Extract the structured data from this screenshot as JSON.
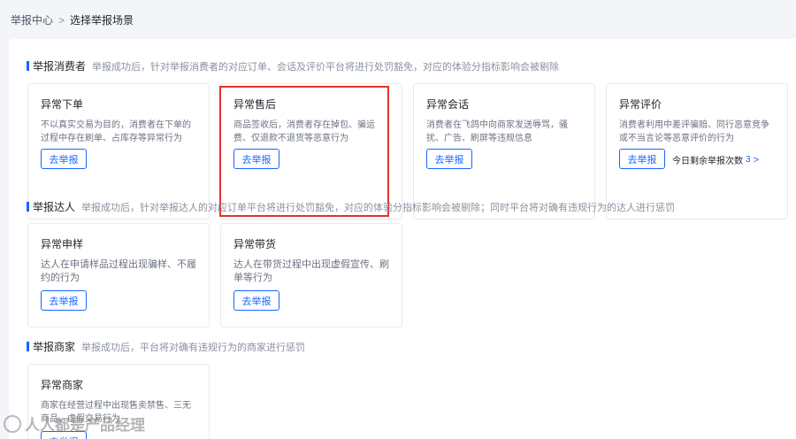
{
  "breadcrumb": {
    "root": "举报中心",
    "separator": ">",
    "current": "选择举报场景"
  },
  "sections": [
    {
      "label": "举报消费者",
      "note": "举报成功后，针对举报消费者的对应订单、会话及评价平台将进行处罚豁免，对应的体验分指标影响会被剔除",
      "cards": [
        {
          "title": "异常下单",
          "desc": "不以真实交易为目的，消费者在下单的过程中存在刷单、占库存等异常行为",
          "button": "去举报"
        },
        {
          "title": "异常售后",
          "desc": "商品签收后，消费者存在掉包、骗运费、仅退款不退货等恶意行为",
          "button": "去举报"
        },
        {
          "title": "异常会话",
          "desc": "消费者在飞鸽中向商家发送辱骂，骚扰、广告、刷屏等违规信息",
          "button": "去举报"
        },
        {
          "title": "异常评价",
          "desc": "消费者利用中差评骗赔、同行恶意竞争或不当言论等恶意评价的行为",
          "button": "去举报",
          "extra_label": "今日剩余举报次数",
          "extra_count": "3",
          "extra_arrow": ">"
        }
      ]
    },
    {
      "label": "举报达人",
      "note": "举报成功后，针对举报达人的对应订单平台将进行处罚豁免，对应的体验分指标影响会被剔除；同时平台将对确有违规行为的达人进行惩罚",
      "cards": [
        {
          "title": "异常申样",
          "desc": "达人在申请样品过程出现骗样、不履约的行为",
          "button": "去举报"
        },
        {
          "title": "异常带货",
          "desc": "达人在带货过程中出现虚假宣传、刷单等行为",
          "button": "去举报"
        }
      ]
    },
    {
      "label": "举报商家",
      "note": "举报成功后，平台将对确有违规行为的商家进行惩罚",
      "cards": [
        {
          "title": "异常商家",
          "desc": "商家在经营过程中出现售卖禁售、三无商品、虚假交易行为",
          "button": "去举报"
        }
      ]
    }
  ],
  "watermark": "人人都是产品经理",
  "colors": {
    "accent": "#1966ff",
    "highlight": "#e3312d",
    "background": "#f3f5f9"
  }
}
